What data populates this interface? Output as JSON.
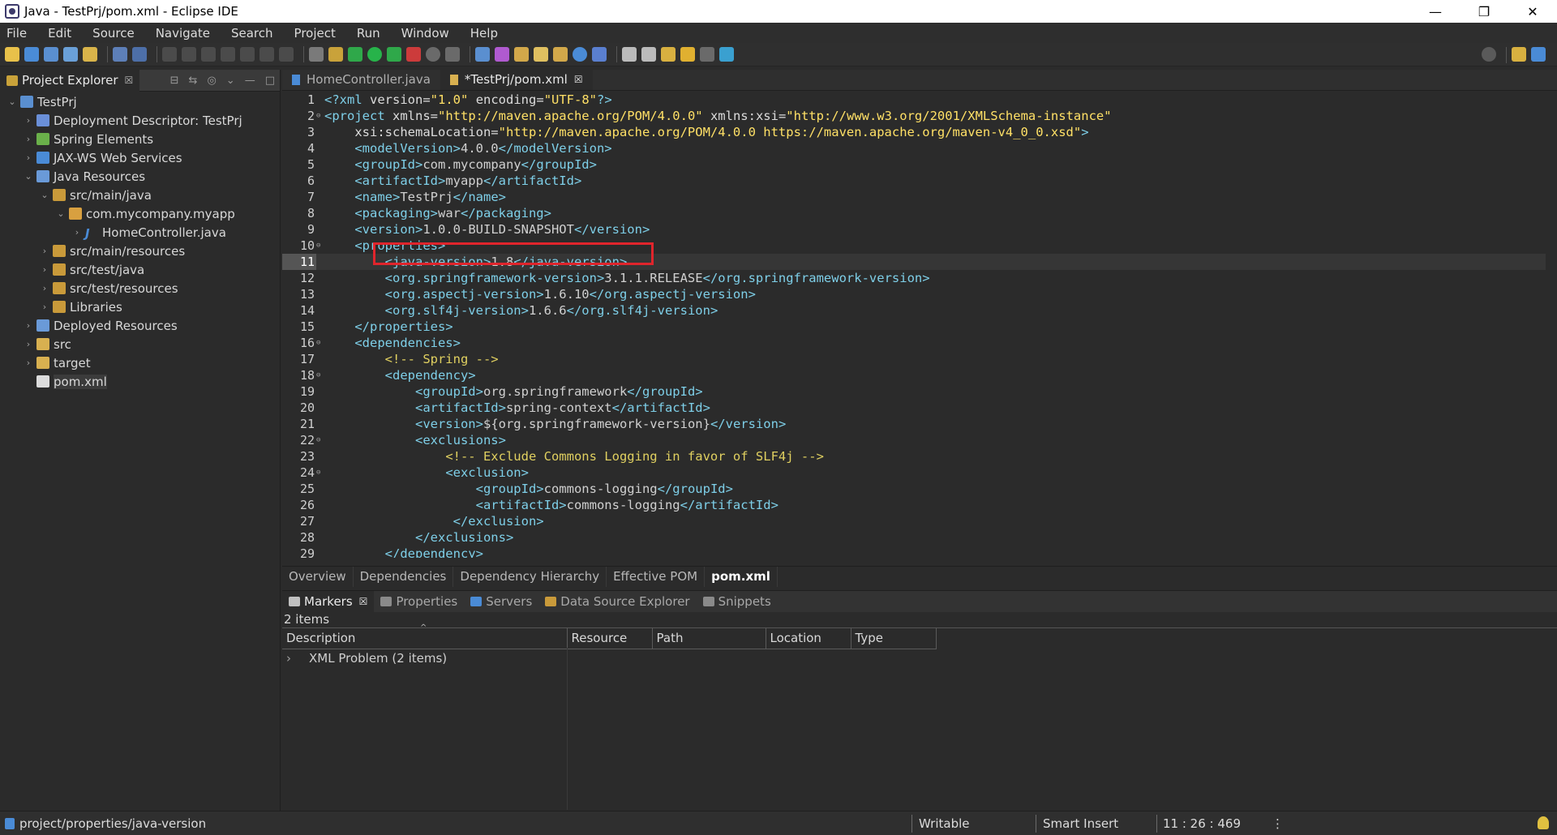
{
  "window": {
    "title": "Java - TestPrj/pom.xml - Eclipse IDE",
    "minimize": "—",
    "restore": "❐",
    "close": "✕"
  },
  "menu": [
    "File",
    "Edit",
    "Source",
    "Navigate",
    "Search",
    "Project",
    "Run",
    "Window",
    "Help"
  ],
  "explorer": {
    "tab_label": "Project Explorer",
    "tab_close": "☒",
    "tree": [
      {
        "label": "TestPrj",
        "arrow": "⌄",
        "indent": 0,
        "icon": "project-icon"
      },
      {
        "label": "Deployment Descriptor: TestPrj",
        "arrow": "›",
        "indent": 1,
        "icon": "deployment-descriptor-icon"
      },
      {
        "label": "Spring Elements",
        "arrow": "›",
        "indent": 1,
        "icon": "spring-icon"
      },
      {
        "label": "JAX-WS Web Services",
        "arrow": "›",
        "indent": 1,
        "icon": "web-services-icon"
      },
      {
        "label": "Java Resources",
        "arrow": "⌄",
        "indent": 1,
        "icon": "java-resources-icon"
      },
      {
        "label": "src/main/java",
        "arrow": "⌄",
        "indent": 2,
        "icon": "source-folder-icon"
      },
      {
        "label": "com.mycompany.myapp",
        "arrow": "⌄",
        "indent": 3,
        "icon": "package-icon"
      },
      {
        "label": "HomeController.java",
        "arrow": "›",
        "indent": 4,
        "icon": "java-file-icon"
      },
      {
        "label": "src/main/resources",
        "arrow": "›",
        "indent": 2,
        "icon": "source-folder-icon"
      },
      {
        "label": "src/test/java",
        "arrow": "›",
        "indent": 2,
        "icon": "source-folder-icon"
      },
      {
        "label": "src/test/resources",
        "arrow": "›",
        "indent": 2,
        "icon": "source-folder-icon"
      },
      {
        "label": "Libraries",
        "arrow": "›",
        "indent": 2,
        "icon": "libraries-icon"
      },
      {
        "label": "Deployed Resources",
        "arrow": "›",
        "indent": 1,
        "icon": "deployed-resources-icon"
      },
      {
        "label": "src",
        "arrow": "›",
        "indent": 1,
        "icon": "folder-icon"
      },
      {
        "label": "target",
        "arrow": "›",
        "indent": 1,
        "icon": "folder-icon"
      },
      {
        "label": "pom.xml",
        "arrow": "",
        "indent": 1,
        "icon": "xml-file-icon",
        "selected": true
      }
    ]
  },
  "editor": {
    "tabs": [
      {
        "label": "HomeController.java",
        "active": false,
        "close": ""
      },
      {
        "label": "*TestPrj/pom.xml",
        "active": true,
        "close": "☒"
      }
    ],
    "current_line": 11,
    "lines": [
      {
        "n": "1",
        "fold": "",
        "html": "<span class='t'>&lt;?xml</span> <span class='v'>version=</span><span class='s'>\"1.0\"</span> <span class='v'>encoding=</span><span class='s'>\"UTF-8\"</span><span class='t'>?&gt;</span>"
      },
      {
        "n": "2",
        "fold": "⊖",
        "html": "<span class='t'>&lt;project</span> <span class='v'>xmlns=</span><span class='s'>\"http://maven.apache.org/POM/4.0.0\"</span> <span class='v'>xmlns:xsi=</span><span class='s'>\"http://www.w3.org/2001/XMLSchema-instance\"</span>"
      },
      {
        "n": "3",
        "fold": "",
        "html": "    <span class='v'>xsi:schemaLocation=</span><span class='s'>\"http://maven.apache.org/POM/4.0.0 https://maven.apache.org/maven-v4_0_0.xsd\"</span><span class='t'>&gt;</span>"
      },
      {
        "n": "4",
        "fold": "",
        "html": "    <span class='t'>&lt;modelVersion&gt;</span>4.0.0<span class='t'>&lt;/modelVersion&gt;</span>"
      },
      {
        "n": "5",
        "fold": "",
        "html": "    <span class='t'>&lt;groupId&gt;</span>com.mycompany<span class='t'>&lt;/groupId&gt;</span>"
      },
      {
        "n": "6",
        "fold": "",
        "html": "    <span class='t'>&lt;artifactId&gt;</span>myapp<span class='t'>&lt;/artifactId&gt;</span>"
      },
      {
        "n": "7",
        "fold": "",
        "html": "    <span class='t'>&lt;name&gt;</span>TestPrj<span class='t'>&lt;/name&gt;</span>"
      },
      {
        "n": "8",
        "fold": "",
        "html": "    <span class='t'>&lt;packaging&gt;</span>war<span class='t'>&lt;/packaging&gt;</span>"
      },
      {
        "n": "9",
        "fold": "",
        "html": "    <span class='t'>&lt;version&gt;</span>1.0.0-BUILD-SNAPSHOT<span class='t'>&lt;/version&gt;</span>"
      },
      {
        "n": "10",
        "fold": "⊖",
        "html": "    <span class='t'>&lt;properties&gt;</span>"
      },
      {
        "n": "11",
        "fold": "",
        "html": "        <span class='t'>&lt;java-version&gt;</span>1.8<span class='t'>&lt;/java-version&gt;</span>"
      },
      {
        "n": "12",
        "fold": "",
        "html": "        <span class='t'>&lt;org.springframework-version&gt;</span>3.1.1.RELEASE<span class='t'>&lt;/org.springframework-version&gt;</span>"
      },
      {
        "n": "13",
        "fold": "",
        "html": "        <span class='t'>&lt;org.aspectj-version&gt;</span>1.6.10<span class='t'>&lt;/org.aspectj-version&gt;</span>"
      },
      {
        "n": "14",
        "fold": "",
        "html": "        <span class='t'>&lt;org.slf4j-version&gt;</span>1.6.6<span class='t'>&lt;/org.slf4j-version&gt;</span>"
      },
      {
        "n": "15",
        "fold": "",
        "html": "    <span class='t'>&lt;/properties&gt;</span>"
      },
      {
        "n": "16",
        "fold": "⊖",
        "html": "    <span class='t'>&lt;dependencies&gt;</span>"
      },
      {
        "n": "17",
        "fold": "",
        "html": "        <span class='cm'>&lt;!-- Spring --&gt;</span>"
      },
      {
        "n": "18",
        "fold": "⊖",
        "html": "        <span class='t'>&lt;dependency&gt;</span>"
      },
      {
        "n": "19",
        "fold": "",
        "html": "            <span class='t'>&lt;groupId&gt;</span>org.springframework<span class='t'>&lt;/groupId&gt;</span>"
      },
      {
        "n": "20",
        "fold": "",
        "html": "            <span class='t'>&lt;artifactId&gt;</span>spring-context<span class='t'>&lt;/artifactId&gt;</span>"
      },
      {
        "n": "21",
        "fold": "",
        "html": "            <span class='t'>&lt;version&gt;</span>${org.springframework-version}<span class='t'>&lt;/version&gt;</span>"
      },
      {
        "n": "22",
        "fold": "⊖",
        "html": "            <span class='t'>&lt;exclusions&gt;</span>"
      },
      {
        "n": "23",
        "fold": "",
        "html": "                <span class='cm'>&lt;!-- Exclude Commons Logging in favor of SLF4j --&gt;</span>"
      },
      {
        "n": "24",
        "fold": "⊖",
        "html": "                <span class='t'>&lt;exclusion&gt;</span>"
      },
      {
        "n": "25",
        "fold": "",
        "html": "                    <span class='t'>&lt;groupId&gt;</span>commons-logging<span class='t'>&lt;/groupId&gt;</span>"
      },
      {
        "n": "26",
        "fold": "",
        "html": "                    <span class='t'>&lt;artifactId&gt;</span>commons-logging<span class='t'>&lt;/artifactId&gt;</span>"
      },
      {
        "n": "27",
        "fold": "",
        "html": "                 <span class='t'>&lt;/exclusion&gt;</span>"
      },
      {
        "n": "28",
        "fold": "",
        "html": "            <span class='t'>&lt;/exclusions&gt;</span>"
      },
      {
        "n": "29",
        "fold": "",
        "html": "        <span class='t'>&lt;/dependency&gt;</span>"
      }
    ],
    "bottom_tabs": [
      {
        "label": "Overview",
        "active": false
      },
      {
        "label": "Dependencies",
        "active": false
      },
      {
        "label": "Dependency Hierarchy",
        "active": false
      },
      {
        "label": "Effective POM",
        "active": false
      },
      {
        "label": "pom.xml",
        "active": true
      }
    ]
  },
  "markers": {
    "tabs": [
      {
        "label": "Markers",
        "active": true,
        "close": "☒",
        "icon": "markers-icon"
      },
      {
        "label": "Properties",
        "active": false,
        "close": "",
        "icon": "properties-icon"
      },
      {
        "label": "Servers",
        "active": false,
        "close": "",
        "icon": "servers-icon"
      },
      {
        "label": "Data Source Explorer",
        "active": false,
        "close": "",
        "icon": "data-source-icon"
      },
      {
        "label": "Snippets",
        "active": false,
        "close": "",
        "icon": "snippets-icon"
      }
    ],
    "count": "2 items",
    "sort_indicator": "^",
    "columns": [
      "Description",
      "Resource",
      "Path",
      "Location",
      "Type"
    ],
    "rows": [
      {
        "arrow": "›",
        "description": "XML Problem (2 items)"
      }
    ]
  },
  "status": {
    "path": "project/properties/java-version",
    "writable": "Writable",
    "insert_mode": "Smart Insert",
    "position": "11 : 26 : 469",
    "more": "⋮"
  },
  "colors": {
    "selection_highlight": "#e0252c",
    "tag": "#7ecfe8",
    "string": "#ffe066"
  }
}
